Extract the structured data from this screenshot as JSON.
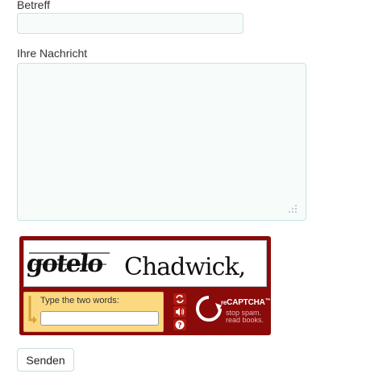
{
  "form": {
    "subject_label": "Betreff",
    "subject_value": "",
    "message_label": "Ihre Nachricht",
    "message_value": "",
    "submit_label": "Senden"
  },
  "captcha": {
    "word1": "gotelo",
    "word2": "Chadwick,",
    "prompt": "Type the two words:",
    "input_value": "",
    "brand_prefix": "re",
    "brand_name": "CAPTCHA",
    "brand_mark": "™",
    "tagline_line1": "stop spam.",
    "tagline_line2": "read books.",
    "colors": {
      "frame": "#8b0a0a",
      "panel": "#fcd981",
      "button": "#b11a0f"
    },
    "icons": [
      "reload-icon",
      "audio-icon",
      "help-icon"
    ]
  }
}
